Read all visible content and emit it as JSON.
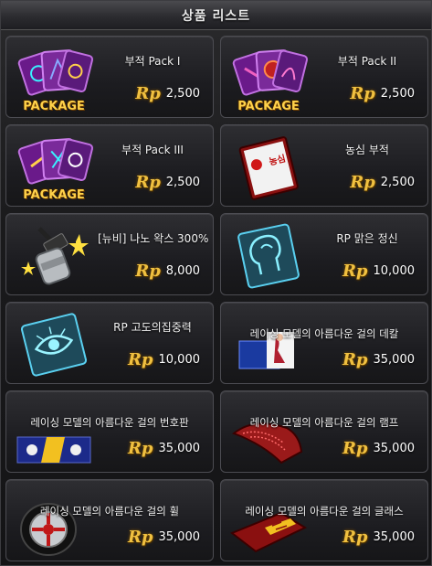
{
  "title": "상품 리스트",
  "currency_label": "Rp",
  "items": [
    {
      "name": "부적 Pack I",
      "price": "2,500",
      "badge": "PACKAGE",
      "icon": "purple-charm-pack-icon"
    },
    {
      "name": "부적 Pack II",
      "price": "2,500",
      "badge": "PACKAGE",
      "icon": "purple-charm-pack-icon"
    },
    {
      "name": "부적 Pack III",
      "price": "2,500",
      "badge": "PACKAGE",
      "icon": "purple-charm-pack-icon"
    },
    {
      "name": "농심 부적",
      "price": "2,500",
      "icon": "nongshim-charm-icon",
      "charm_text": "농심"
    },
    {
      "name": "[뉴비] 나노 왁스 300%",
      "price": "8,000",
      "icon": "wax-spray-icon"
    },
    {
      "name": "RP 맑은 정신",
      "price": "10,000",
      "icon": "blue-head-card-icon"
    },
    {
      "name": "RP 고도의집중력",
      "price": "10,000",
      "icon": "blue-eye-card-icon"
    },
    {
      "name": "레이싱 모델의 아름다운 걸의 데칼",
      "price": "35,000",
      "icon": "decal-icon"
    },
    {
      "name": "레이싱 모델의 아름다운 걸의 번호판",
      "price": "35,000",
      "icon": "license-plate-icon"
    },
    {
      "name": "레이싱 모델의 아름다운 걸의 램프",
      "price": "35,000",
      "icon": "lamp-icon"
    },
    {
      "name": "레이싱 모델의 아름다운 걸의 휠",
      "price": "35,000",
      "icon": "wheel-icon"
    },
    {
      "name": "레이싱 모델의 아름다운 걸의 글래스",
      "price": "35,000",
      "icon": "glass-icon"
    }
  ]
}
